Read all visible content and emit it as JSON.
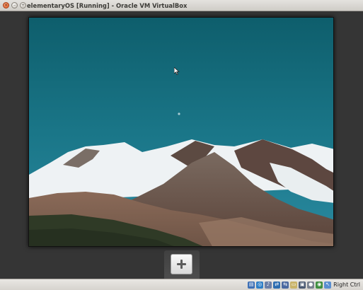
{
  "window": {
    "title": "elementaryOS [Running] - Oracle VM VirtualBox",
    "buttons": {
      "close": "×",
      "minimize": "–",
      "maximize": "+"
    }
  },
  "desktop": {
    "wallpaper": "mountain-landscape",
    "dock": {
      "add_button": "plus-icon"
    }
  },
  "statusbar": {
    "icons": [
      {
        "name": "hard-disk-icon",
        "color": "#3d6fb5",
        "glyph": "▤"
      },
      {
        "name": "optical-drive-icon",
        "color": "#2f7fc7",
        "glyph": "◎"
      },
      {
        "name": "audio-icon",
        "color": "#6a7fa8",
        "glyph": "♪"
      },
      {
        "name": "network-icon",
        "color": "#2d6db0",
        "glyph": "⇄"
      },
      {
        "name": "usb-icon",
        "color": "#4a68a0",
        "glyph": "⇆"
      },
      {
        "name": "shared-folders-icon",
        "color": "#c9b46a",
        "glyph": "▭"
      },
      {
        "name": "display-icon",
        "color": "#4b5a72",
        "glyph": "▣"
      },
      {
        "name": "video-capture-icon",
        "color": "#7a8290",
        "glyph": "●"
      },
      {
        "name": "cpu-icon",
        "color": "#3f8f3f",
        "glyph": "◉"
      },
      {
        "name": "mouse-integration-icon",
        "color": "#5b8fd0",
        "glyph": "↖"
      }
    ],
    "host_key": "Right Ctrl"
  }
}
